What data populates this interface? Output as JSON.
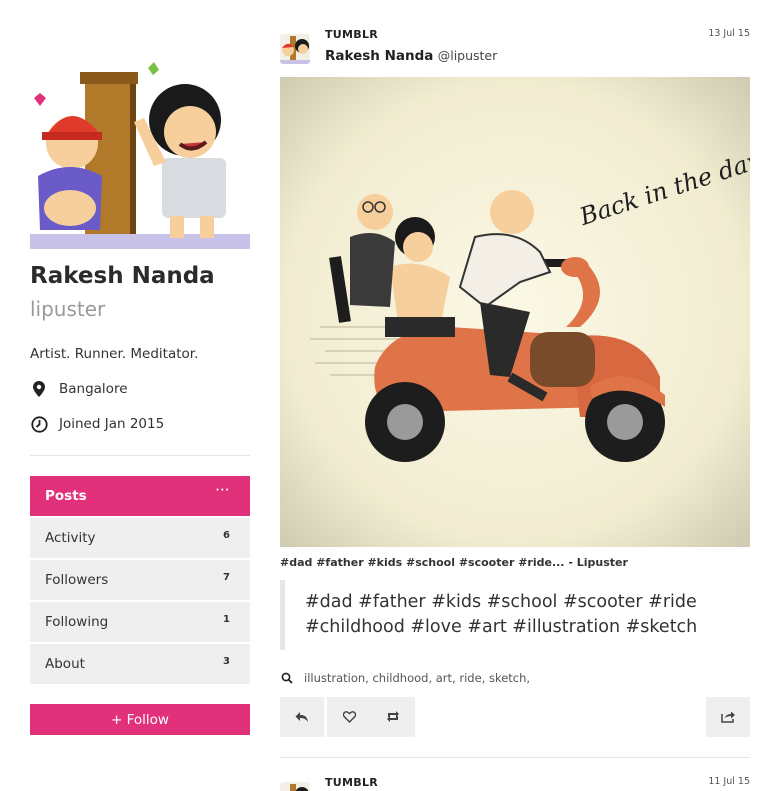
{
  "profile": {
    "name": "Rakesh Nanda",
    "handle": "lipuster",
    "bio": "Artist. Runner. Meditator.",
    "location": "Bangalore",
    "joined": "Joined Jan 2015"
  },
  "nav": {
    "items": [
      {
        "label": "Posts",
        "count": "···",
        "active": true
      },
      {
        "label": "Activity",
        "count": "6"
      },
      {
        "label": "Followers",
        "count": "7"
      },
      {
        "label": "Following",
        "count": "1"
      },
      {
        "label": "About",
        "count": "3"
      }
    ],
    "follow_label": "+ Follow"
  },
  "posts": [
    {
      "source": "TUMBLR",
      "author_name": "Rakesh Nanda",
      "author_handle": "@lipuster",
      "date": "13 Jul 15",
      "image_text": "Back in the days...",
      "caption": "#dad #father #kids #school #scooter #ride... - Lipuster",
      "quote_line1": "#dad #father #kids #school #scooter #ride",
      "quote_line2": "#childhood #love #art #illustration #sketch",
      "tags": "illustration, childhood, art, ride, sketch,"
    },
    {
      "source": "TUMBLR",
      "date": "11 Jul 15"
    }
  ],
  "colors": {
    "accent": "#e0317a",
    "nav_bg": "#efefef",
    "text": "#333333",
    "muted": "#9a9a9a"
  },
  "icons": {
    "location": "location-pin-icon",
    "joined": "clock-icon",
    "search": "search-icon",
    "reply": "reply-icon",
    "like": "heart-icon",
    "reblog": "reblog-icon",
    "share": "share-icon"
  }
}
